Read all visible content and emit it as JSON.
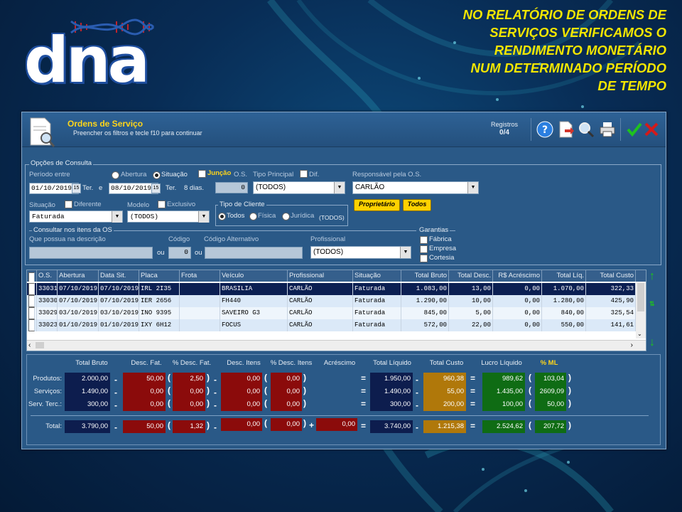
{
  "colors": {
    "accent": "#ffd51a",
    "headline": "#f2e500",
    "selected_row": "#0b1f52",
    "success": "#1ec21e",
    "danger": "#d31a1a"
  },
  "logo": {
    "text": "dna"
  },
  "headline": {
    "lines": [
      "NO RELATÓRIO DE ORDENS DE",
      "SERVIÇOS  VERIFICAMOS O",
      "RENDIMENTO MONETÁRIO",
      "NUM DETERMINADO PERÍODO",
      "DE TEMPO"
    ]
  },
  "window": {
    "title": "Ordens de Serviço",
    "subtitle": "Preencher os filtros e tecle f10 para continuar",
    "registros_label": "Registros",
    "registros_value": "0/4",
    "toolbar_icons": [
      "help-icon",
      "export-icon",
      "search-icon",
      "print-icon",
      "confirm-icon",
      "close-icon"
    ]
  },
  "filters": {
    "group_title": "Opções de Consulta",
    "periodo_label": "Período entre",
    "abertura_label": "Abertura",
    "situacao_radio_label": "Situação",
    "juncao_label": "Junção",
    "os_label": "O.S.",
    "tipo_principal_label": "Tipo Principal",
    "dif_label": "Dif.",
    "responsavel_label": "Responsável pela O.S.",
    "date_from": "01/10/2019",
    "day_from": "Ter.",
    "e_label": "e",
    "date_to": "08/10/2019",
    "day_to": "Ter.",
    "dias": "8 dias.",
    "os_value": "0",
    "tipo_principal_value": "(TODOS)",
    "responsavel_value": "CARLÃO",
    "situacao_label": "Situação",
    "diferente_label": "Diferente",
    "modelo_label": "Modelo",
    "exclusivo_label": "Exclusivo",
    "situacao_value": "Faturada",
    "modelo_value": "(TODOS)",
    "tipo_cliente_title": "Tipo de Cliente",
    "todos_radio": "Todos",
    "fisica_radio": "Física",
    "juridica_radio": "Jurídica",
    "tipo_cliente_value": "(TODOS)",
    "proprietario_btn": "Proprietário",
    "todos_btn": "Todos",
    "itens_title": "Consultar nos itens da OS",
    "descricao_label": "Que possua na descrição",
    "codigo_label": "Código",
    "codigo_alt_label": "Código Alternativo",
    "profissional_label": "Profissional",
    "ou1": "ou",
    "ou2": "ou",
    "codigo_value": "0",
    "profissional_value": "(TODOS)",
    "garantias_title": "Garantias",
    "garantia_fabrica": "Fábrica",
    "garantia_empresa": "Empresa",
    "garantia_cortesia": "Cortesia"
  },
  "table": {
    "headers": [
      "O.S.",
      "Abertura",
      "Data Sit.",
      "Placa",
      "Frota",
      "Veículo",
      "Profissional",
      "Situação",
      "Total Bruto",
      "Total Desc.",
      "R$ Acréscimo",
      "Total Líq.",
      "Total Custo"
    ],
    "rows": [
      [
        "33031",
        "07/10/2019",
        "07/10/2019",
        "IRL 2I35",
        "",
        "BRASILIA",
        "CARLÃO",
        "Faturada",
        "1.083,00",
        "13,00",
        "0,00",
        "1.070,00",
        "322,33"
      ],
      [
        "33030",
        "07/10/2019",
        "07/10/2019",
        "IER 2656",
        "",
        "FH440",
        "CARLÃO",
        "Faturada",
        "1.290,00",
        "10,00",
        "0,00",
        "1.280,00",
        "425,90"
      ],
      [
        "33029",
        "03/10/2019",
        "03/10/2019",
        "INO 9395",
        "",
        "SAVEIRO G3",
        "CARLÃO",
        "Faturada",
        "845,00",
        "5,00",
        "0,00",
        "840,00",
        "325,54"
      ],
      [
        "33023",
        "01/10/2019",
        "01/10/2019",
        "IXY 6H12",
        "",
        "FOCUS",
        "CARLÃO",
        "Faturada",
        "572,00",
        "22,00",
        "0,00",
        "550,00",
        "141,61"
      ]
    ]
  },
  "totals": {
    "headers": {
      "bruto": "Total Bruto",
      "desc_fat": "Desc. Fat.",
      "pct_desc_fat": "% Desc. Fat.",
      "desc_itens": "Desc. Itens",
      "pct_desc_itens": "% Desc. Itens",
      "acrescimo": "Acréscimo",
      "liquido": "Total Líquido",
      "custo": "Total Custo",
      "lucro": "Lucro Líquido",
      "ml": "% ML"
    },
    "rows": [
      {
        "label": "Produtos:",
        "bruto": "2.000,00",
        "desc_fat": "50,00",
        "pct_desc_fat": "2,50",
        "desc_itens": "0,00",
        "pct_desc_itens": "0,00",
        "liquido": "1.950,00",
        "custo": "960,38",
        "lucro": "989,62",
        "ml": "103,04"
      },
      {
        "label": "Serviços:",
        "bruto": "1.490,00",
        "desc_fat": "0,00",
        "pct_desc_fat": "0,00",
        "desc_itens": "0,00",
        "pct_desc_itens": "0,00",
        "liquido": "1.490,00",
        "custo": "55,00",
        "lucro": "1.435,00",
        "ml": "2609,09"
      },
      {
        "label": "Serv. Terc.:",
        "bruto": "300,00",
        "desc_fat": "0,00",
        "pct_desc_fat": "0,00",
        "desc_itens": "0,00",
        "pct_desc_itens": "0,00",
        "liquido": "300,00",
        "custo": "200,00",
        "lucro": "100,00",
        "ml": "50,00"
      }
    ],
    "total": {
      "label": "Total:",
      "bruto": "3.790,00",
      "desc_fat": "50,00",
      "pct_desc_fat": "1,32",
      "desc_itens": "0,00",
      "pct_desc_itens": "0,00",
      "acrescimo": "0,00",
      "liquido": "3.740,00",
      "custo": "1.215,38",
      "lucro": "2.524,62",
      "ml": "207,72"
    }
  }
}
